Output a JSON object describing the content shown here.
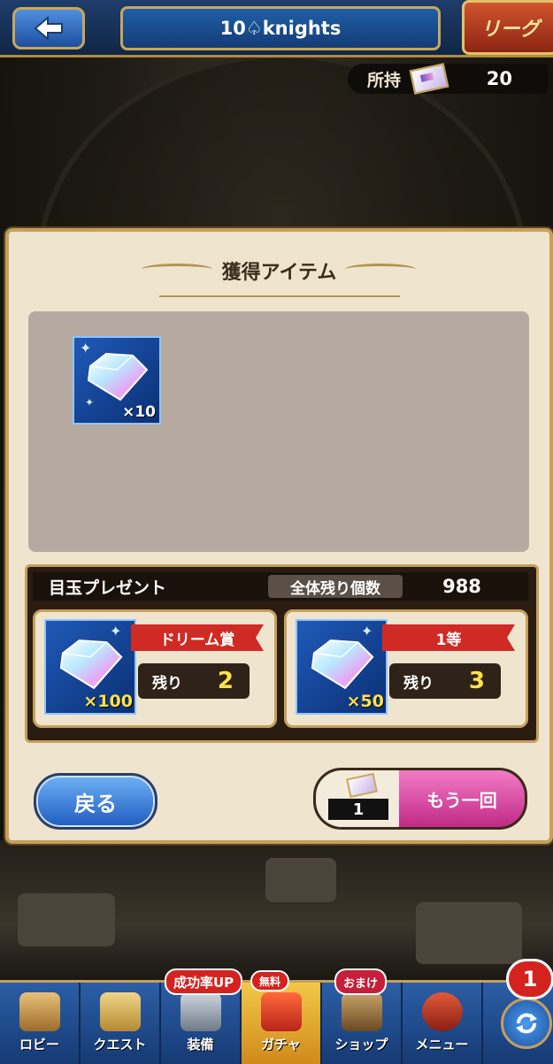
{
  "header": {
    "title": "10♤knights",
    "league_label": "リーグ"
  },
  "owned": {
    "label": "所持",
    "count": "20"
  },
  "panel": {
    "title": "獲得アイテム",
    "items": [
      {
        "name": "gem",
        "quantity": "×10"
      }
    ]
  },
  "present": {
    "title": "目玉プレゼント",
    "remaining_label": "全体残り個数",
    "remaining_value": "988",
    "prizes": [
      {
        "name": "ドリーム賞",
        "quantity": "×100",
        "remain_label": "残り",
        "remain_value": "2"
      },
      {
        "name": "1等",
        "quantity": "×50",
        "remain_label": "残り",
        "remain_value": "3"
      }
    ]
  },
  "buttons": {
    "back_label": "戻る",
    "again_count": "1",
    "again_label": "もう一回"
  },
  "nav": {
    "items": [
      {
        "label": "ロビー",
        "icon": "lobby-icon"
      },
      {
        "label": "クエスト",
        "icon": "quest-icon"
      },
      {
        "label": "装備",
        "icon": "equipment-icon",
        "badge": "成功率UP"
      },
      {
        "label": "ガチャ",
        "icon": "gacha-icon",
        "badge": "無料"
      },
      {
        "label": "ショップ",
        "icon": "shop-icon",
        "badge": "おまけ"
      },
      {
        "label": "メニュー",
        "icon": "menu-icon"
      }
    ],
    "notification_count": "1"
  },
  "colors": {
    "accent_gold": "#c5a05a",
    "prize_red": "#d02a24",
    "again_pink": "#e34fa9",
    "value_yellow": "#ffe24a"
  }
}
